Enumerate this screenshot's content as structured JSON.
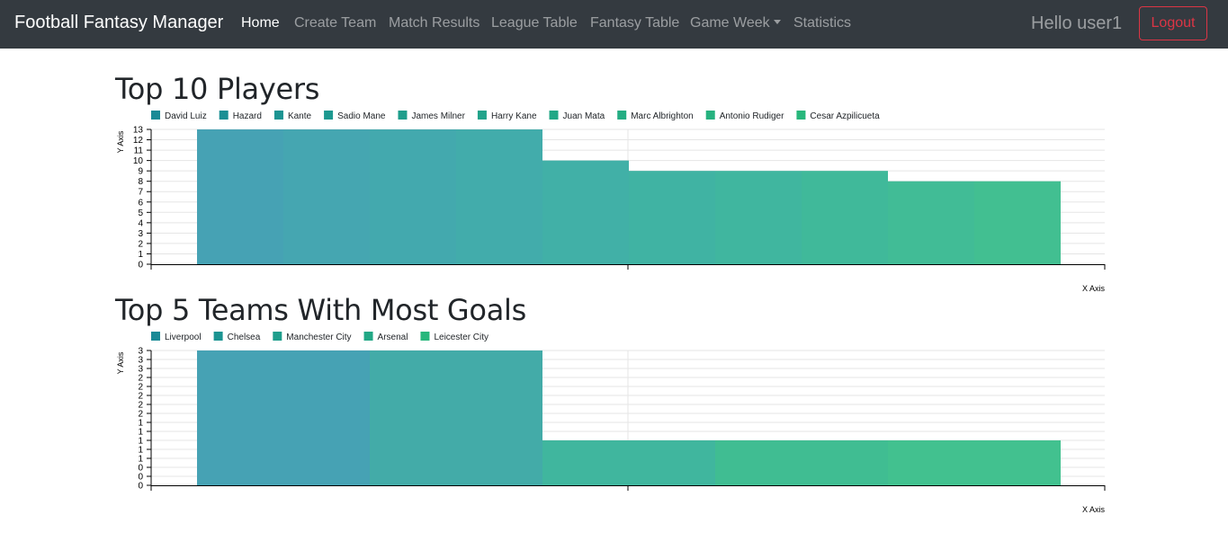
{
  "navbar": {
    "brand": "Football Fantasy Manager",
    "links": [
      {
        "label": "Home",
        "active": true
      },
      {
        "label": "Create Team",
        "active": false
      },
      {
        "label": "Match Results",
        "active": false
      },
      {
        "label": "League Table",
        "active": false
      },
      {
        "label": "Fantasy Table",
        "active": false
      },
      {
        "label": "Game Week",
        "active": false,
        "dropdown": true
      },
      {
        "label": "Statistics",
        "active": false
      }
    ],
    "greeting": "Hello user1",
    "logout_label": "Logout"
  },
  "sections": {
    "players_title": "Top 10 Players",
    "teams_title": "Top 5 Teams With Most Goals"
  },
  "chart_data": [
    {
      "type": "bar",
      "categories": [
        "David Luiz",
        "Hazard",
        "Kante",
        "Sadio Mane",
        "James Milner",
        "Harry Kane",
        "Juan Mata",
        "Marc Albrighton",
        "Antonio Rudiger",
        "Cesar Azpilicueta"
      ],
      "values": [
        13,
        13,
        13,
        13,
        10,
        9,
        9,
        9,
        8,
        8
      ],
      "yticks": [
        "0",
        "1",
        "2",
        "3",
        "4",
        "5",
        "6",
        "7",
        "8",
        "9",
        "10",
        "11",
        "12",
        "13"
      ],
      "ylim": [
        0,
        13
      ],
      "xlabel": "X Axis",
      "ylabel": "Y Axis",
      "legend": "top-left",
      "grid": true,
      "colors": [
        "#1a8a96",
        "#1b8f94",
        "#1c9492",
        "#1d9990",
        "#1f9e8c",
        "#21a38a",
        "#22a886",
        "#24ad83",
        "#26b27f",
        "#28b77c"
      ],
      "bar_colors": [
        "#46a2b4",
        "#45a6b1",
        "#43a9ae",
        "#42acab",
        "#41b0a7",
        "#40b3a3",
        "#40b69f",
        "#40b99a",
        "#41bc96",
        "#42bf91"
      ]
    },
    {
      "type": "bar",
      "categories": [
        "Liverpool",
        "Chelsea",
        "Manchester City",
        "Arsenal",
        "Leicester City"
      ],
      "values": [
        3,
        3,
        1,
        1,
        1
      ],
      "yticks": [
        "0",
        "0",
        "0",
        "1",
        "1",
        "1",
        "1",
        "1",
        "2",
        "2",
        "2",
        "2",
        "2",
        "3",
        "3",
        "3"
      ],
      "ylim": [
        0,
        3
      ],
      "xlabel": "X Axis",
      "ylabel": "Y Axis",
      "legend": "top-left",
      "grid": true,
      "colors": [
        "#1a8a96",
        "#1c9492",
        "#1f9e8c",
        "#22a886",
        "#28b77c"
      ],
      "bar_colors": [
        "#46a2b4",
        "#43aba8",
        "#40b69e",
        "#40bd92",
        "#42c18f"
      ]
    }
  ]
}
